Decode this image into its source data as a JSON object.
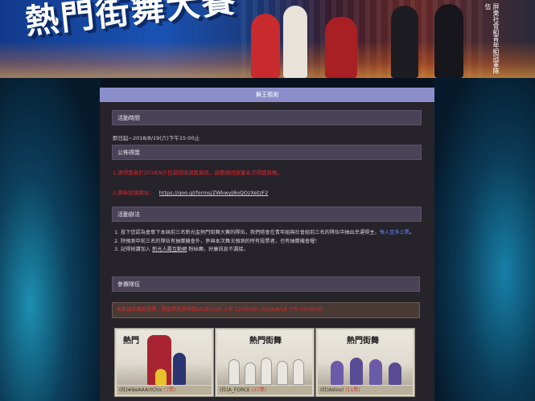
{
  "banner": {
    "title": "熱門街舞大賽",
    "side_text": "屏東社會組青年組冠軍隊伍",
    "colors": {
      "fire": "#ff8a2a",
      "sky": "#1a52b4"
    }
  },
  "panel": {
    "header": "舞王預測",
    "sections": {
      "time": {
        "title": "活動時間",
        "text": "即日起~2018/8/19(六)下午15:00止"
      },
      "winners": {
        "title": "公佈得獎",
        "line1": "1.請得獎者於2018/9/5日前回填領獎資訊，逾期視同放棄本次得獎資格。",
        "line2_label": "2.資料回填網址：",
        "line2_link": "https://goo.gl/forms/ZWkwyJ8oQOzXetzF2"
      },
      "rules": {
        "title": "活動辦法",
        "items": [
          {
            "pre": "投下您認為會奪下本屆前三名新光盃熱門街舞大賽的隊伍，我們將會在青年組與社會組前三名的隊伍中抽出幸運得主，",
            "highlight": "每人至多三票",
            "post": "。"
          },
          {
            "pre": "除預測中前三名的隊伍有抽獎機會外，參與本次舞王預測的所有投票者，也有抽獎機會喔！",
            "highlight": "",
            "post": ""
          },
          {
            "pre": "記得按讚加入 ",
            "link": "新光人壽互動網",
            "post": " 粉絲團，好康訊息不漏接。"
          }
        ]
      },
      "teams": {
        "title": "參賽隊伍",
        "vote_info": "未能出夾難投投票，開放票投票時間2018/7/26 上午 12:00:00~2018/8/18 下午 03:00:00"
      }
    },
    "cards": [
      {
        "name": "(社)#BeAAArtChic",
        "count": "(7票)"
      },
      {
        "name": "(社)A_FORCE",
        "count": "(37票)"
      },
      {
        "name": "(社)Adios!",
        "count": "(11票)"
      }
    ]
  }
}
